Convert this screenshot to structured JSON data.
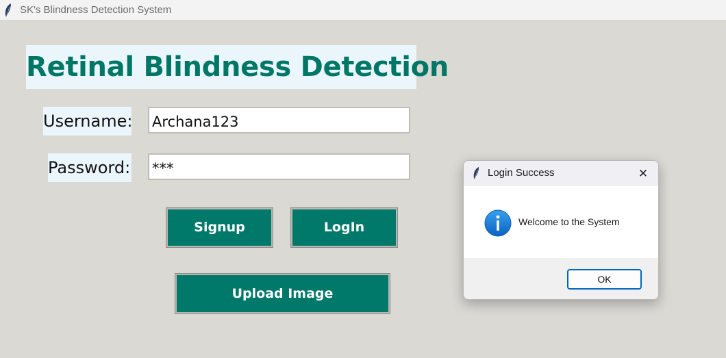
{
  "window": {
    "title": "SK's Blindness Detection System",
    "icon": "feather-icon"
  },
  "main": {
    "heading": "Retinal Blindness Detection",
    "username_label": "Username:",
    "username_value": "Archana123",
    "password_label": "Password:",
    "password_value": "***",
    "signup_label": "Signup",
    "login_label": "LogIn",
    "upload_label": "Upload Image"
  },
  "dialog": {
    "title": "Login Success",
    "close_icon": "close-icon",
    "info_icon": "info-icon",
    "message": "Welcome to the System",
    "ok_label": "OK"
  },
  "colors": {
    "accent": "#00796b",
    "label_bg": "#ebf5fc",
    "window_bg": "#dbd9d4",
    "dialog_button_border": "#0067c0"
  }
}
